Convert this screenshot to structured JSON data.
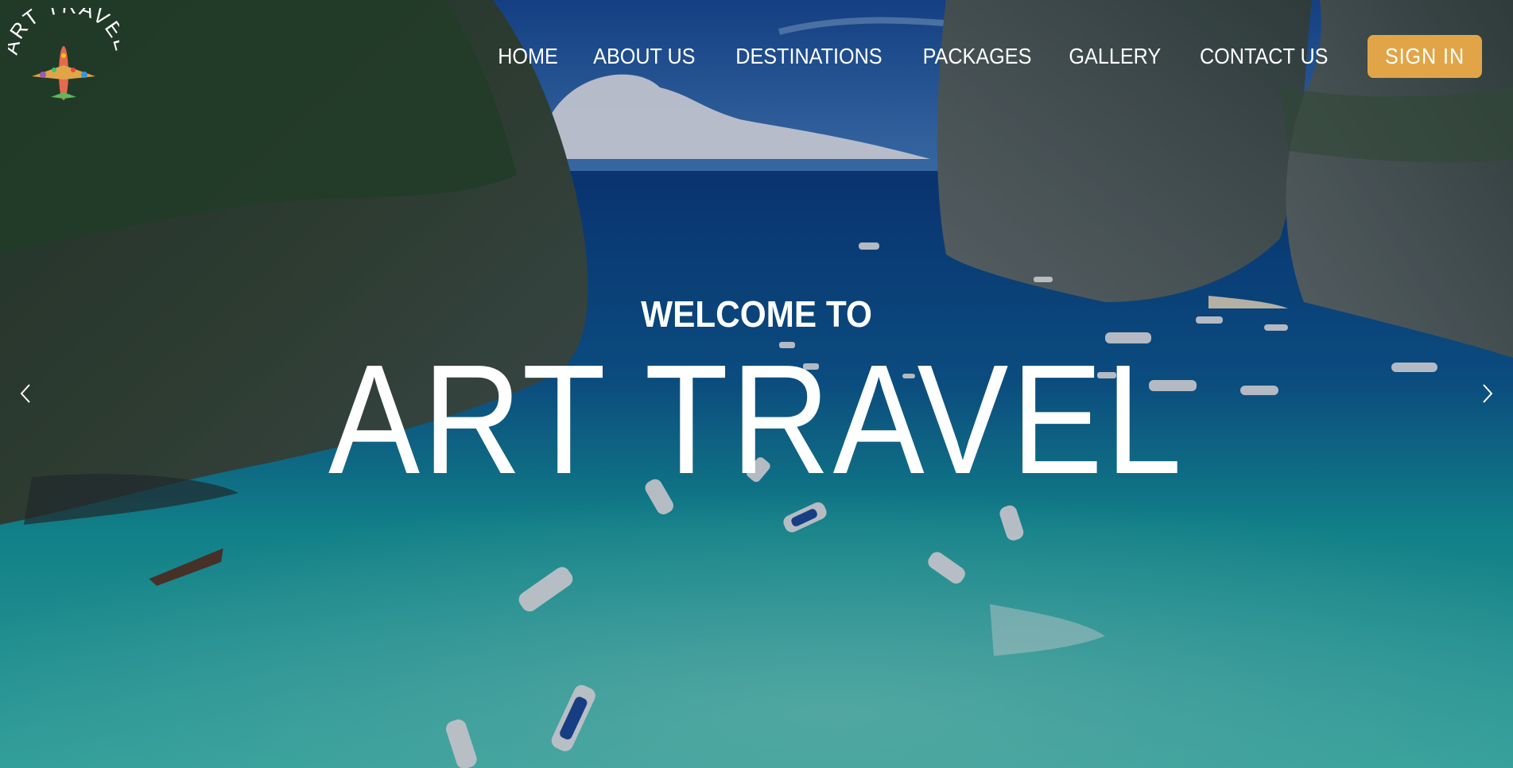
{
  "brand": {
    "logo_text": "ART TRAVEL",
    "logo_icon": "airplane-icon"
  },
  "nav": {
    "items": [
      {
        "label": "HOME"
      },
      {
        "label": "ABOUT US"
      },
      {
        "label": "DESTINATIONS"
      },
      {
        "label": "PACKAGES"
      },
      {
        "label": "GALLERY"
      },
      {
        "label": "CONTACT US"
      }
    ],
    "signin_label": "SIGN IN"
  },
  "hero": {
    "subtitle": "WELCOME TO",
    "title": "ART TRAVEL",
    "prev_icon": "chevron-left-icon",
    "next_icon": "chevron-right-icon"
  },
  "colors": {
    "accent": "#e1a548",
    "text": "#ffffff",
    "sky": "#1f5aa6",
    "sea": "#1fa6a6"
  }
}
